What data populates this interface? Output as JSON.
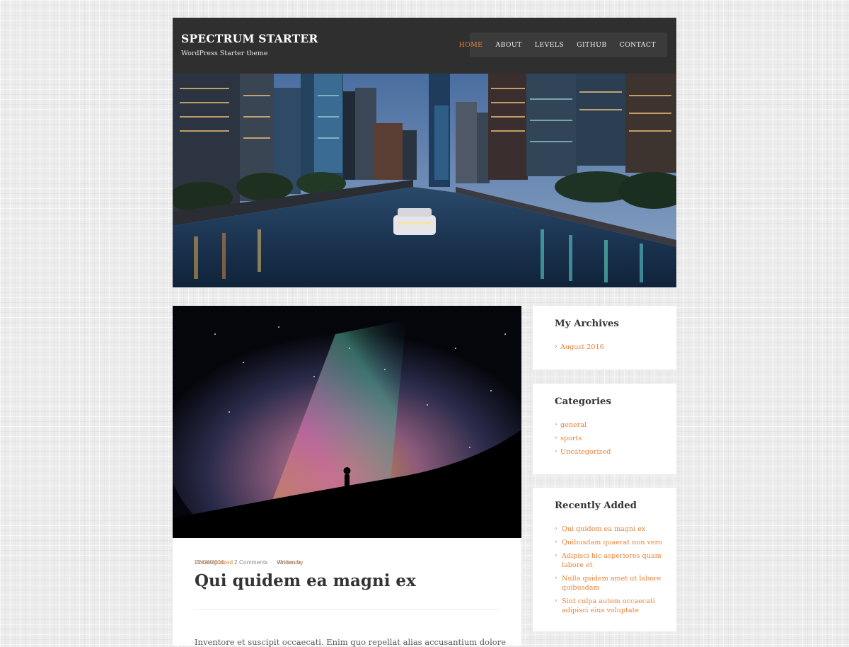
{
  "header": {
    "site_title": "SPECTRUM STARTER",
    "tagline": "WordPress Starter theme",
    "nav": [
      {
        "label": "HOME",
        "active": true
      },
      {
        "label": "ABOUT",
        "active": false
      },
      {
        "label": "LEVELS",
        "active": false
      },
      {
        "label": "GITHUB",
        "active": false
      },
      {
        "label": "CONTACT",
        "active": false
      }
    ]
  },
  "post": {
    "date": "22/08/2016",
    "comments": "2 Comments",
    "written_by": "Written by",
    "author": "Vincenza",
    "category": "Uncategorized",
    "title": "Qui quidem ea magni ex",
    "excerpt": "Inventore et suscipit occaecati. Enim quo repellat alias accusantium dolores Nihil illo"
  },
  "sidebar": {
    "archives": {
      "title": "My Archives",
      "items": [
        "August 2016"
      ]
    },
    "categories": {
      "title": "Categories",
      "items": [
        "general",
        "sports",
        "Uncategorized"
      ]
    },
    "recent": {
      "title": "Recently Added",
      "items": [
        "Qui quidem ea magni ex",
        "Quibusdam quaerat non vero",
        "Adipisci hic asperiores quam labore et",
        "Nulla quidem amet ut labore quibusdam",
        "Sint culpa autem occaecati adipisci eius voluptate"
      ]
    }
  },
  "colors": {
    "accent": "#e8823a",
    "header_bg": "#2f2f2f",
    "nav_bg": "#3b3b3b"
  },
  "icons": {
    "list_bullet": "chevron-right-icon"
  }
}
